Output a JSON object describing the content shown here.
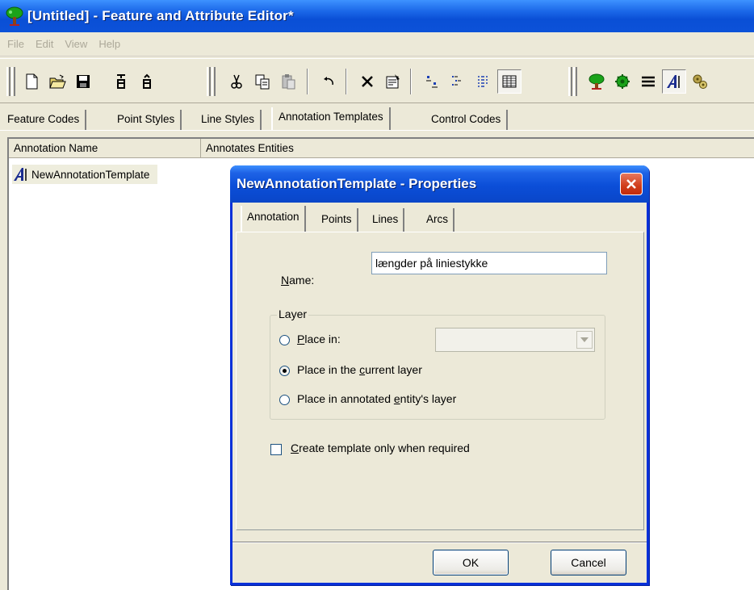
{
  "window": {
    "title": "[Untitled] - Feature and Attribute Editor*"
  },
  "menu": [
    "File",
    "Edit",
    "View",
    "Help"
  ],
  "main_tabs": [
    {
      "label": "Feature Codes"
    },
    {
      "label": "Point Styles"
    },
    {
      "label": "Line Styles"
    },
    {
      "label": "Annotation Templates",
      "active": true
    },
    {
      "label": "Control Codes"
    }
  ],
  "list": {
    "columns": [
      "Annotation Name",
      "Annotates Entities"
    ],
    "rows": [
      {
        "name": "NewAnnotationTemplate",
        "icon": "annotation-a-icon"
      }
    ]
  },
  "dialog": {
    "title": "NewAnnotationTemplate - Properties",
    "tabs": [
      {
        "label": "Annotation",
        "active": true
      },
      {
        "label": "Points"
      },
      {
        "label": "Lines"
      },
      {
        "label": "Arcs"
      }
    ],
    "name_label_key": "N",
    "name_label_rest": "ame:",
    "name_value": "længder på liniestykke",
    "layer_group": "Layer",
    "radio_place_in_key": "P",
    "radio_place_in_rest": "lace in:",
    "radio_current_pre": "Place in the ",
    "radio_current_key": "c",
    "radio_current_post": "urrent layer",
    "radio_entity_pre": "Place in annotated ",
    "radio_entity_key": "e",
    "radio_entity_post": "ntity's layer",
    "selected_radio": "current",
    "checkbox_key": "C",
    "checkbox_rest": "reate template only when required",
    "checkbox_checked": false,
    "ok_label": "OK",
    "cancel_label": "Cancel"
  },
  "colors": {
    "titlebar_blue": "#0a4fd6",
    "dialog_frame": "#0831d9",
    "close_red": "#d03d1a",
    "face": "#ece9d8"
  }
}
